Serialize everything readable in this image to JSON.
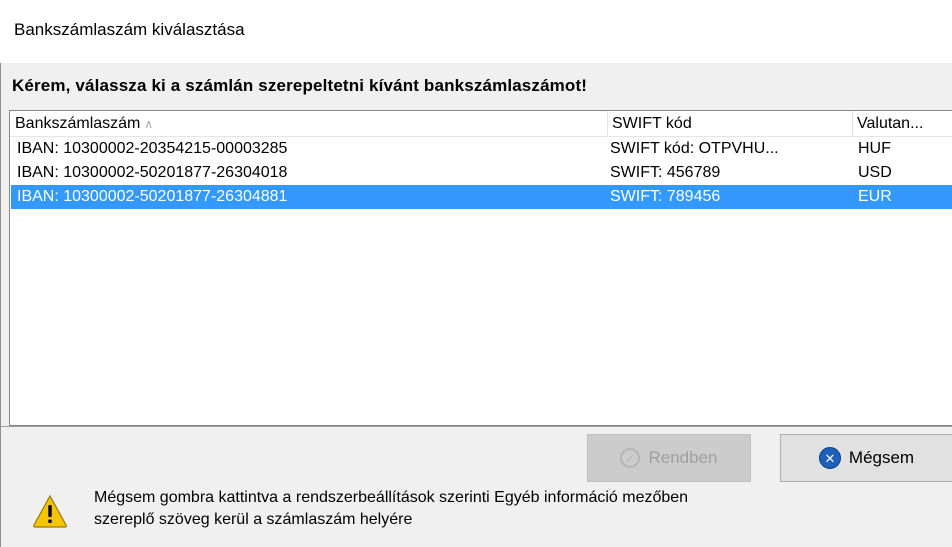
{
  "window": {
    "title": "Bankszámlaszám kiválasztása"
  },
  "instruction": "Kérem, válassza ki a számlán szerepeltetni kívánt bankszámlaszámot!",
  "table": {
    "columns": [
      {
        "label": "Bankszámlaszám",
        "sorted": "ascending"
      },
      {
        "label": "SWIFT kód"
      },
      {
        "label": "Valutan..."
      }
    ],
    "rows": [
      {
        "account": "IBAN: 10300002-20354215-00003285",
        "swift": "SWIFT kód: OTPVHU...",
        "currency": "HUF",
        "selected": false
      },
      {
        "account": "IBAN: 10300002-50201877-26304018",
        "swift": "SWIFT: 456789",
        "currency": "USD",
        "selected": false
      },
      {
        "account": "IBAN: 10300002-50201877-26304881",
        "swift": "SWIFT: 789456",
        "currency": "EUR",
        "selected": true
      }
    ]
  },
  "buttons": {
    "ok_label": "Rendben",
    "ok_enabled": false,
    "cancel_label": "Mégsem"
  },
  "info": {
    "line1": "Mégsem gombra kattintva a rendszerbeállítások szerinti Egyéb információ mezőben",
    "line2": "szereplő szöveg kerül a számlaszám helyére"
  },
  "colors": {
    "selection": "#3399ff",
    "window_bg": "#f0f0f0",
    "warning": "#f5c400"
  }
}
